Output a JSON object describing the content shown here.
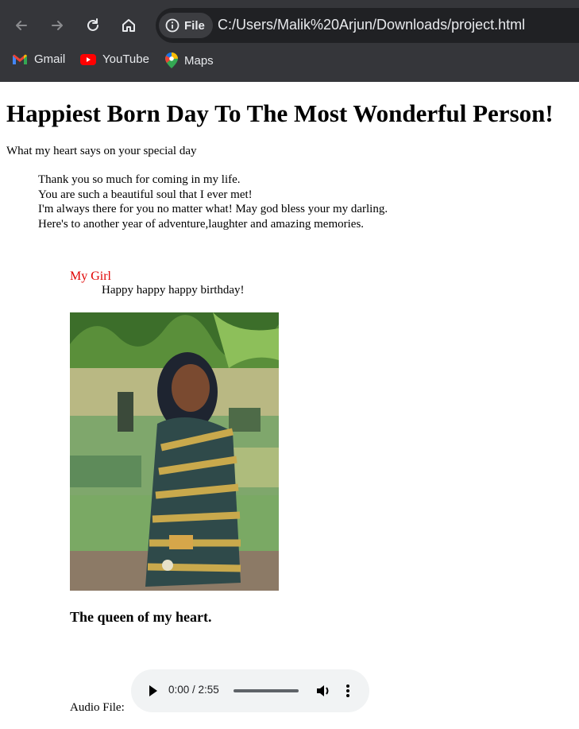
{
  "browser": {
    "back_icon": "arrow-left-icon",
    "forward_icon": "arrow-right-icon",
    "reload_icon": "reload-icon",
    "home_icon": "home-icon",
    "site_info_label": "File",
    "url": "C:/Users/Malik%20Arjun/Downloads/project.html",
    "bookmarks": [
      {
        "label": "Gmail",
        "icon": "gmail-icon"
      },
      {
        "label": "YouTube",
        "icon": "youtube-icon"
      },
      {
        "label": "Maps",
        "icon": "maps-icon"
      }
    ]
  },
  "page": {
    "title": "Happiest Born Day To The Most Wonderful Person!",
    "subtitle": "What my heart says on your special day",
    "message_lines": [
      "Thank you so much for coming in my life.",
      "You are such a beautiful soul that I ever met!",
      "I'm always there for you no matter what! May god bless your my darling.",
      "Here's to another year of adventure,laughter and amazing memories."
    ],
    "girl_label": "My Girl",
    "birthday_line": "Happy happy happy birthday!",
    "photo_caption": "The queen of my heart.",
    "audio_label": "Audio File:",
    "audio_time": "0:00 / 2:55",
    "audio_progress": 0
  },
  "colors": {
    "chrome_bg": "#35363a",
    "urlbar_bg": "#202124",
    "accent_red": "#e00000",
    "audio_bg": "#f1f3f4"
  }
}
